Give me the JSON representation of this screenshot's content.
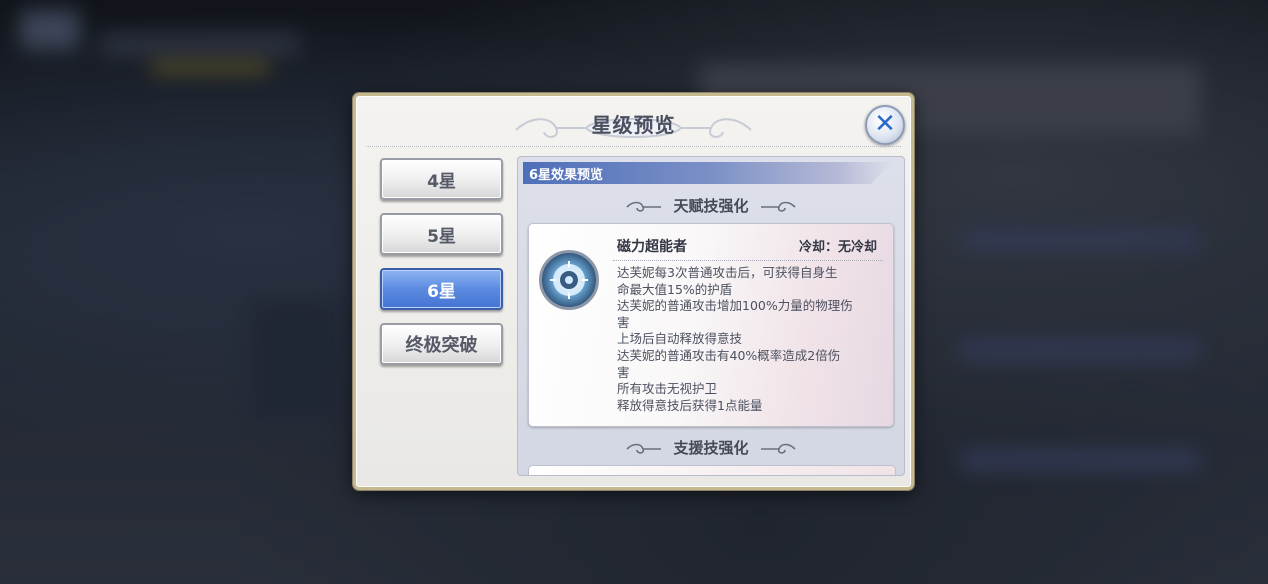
{
  "dialog": {
    "title": "星级预览",
    "close_icon": "close-icon"
  },
  "tabs": [
    {
      "label": "4星",
      "active": false
    },
    {
      "label": "5星",
      "active": false
    },
    {
      "label": "6星",
      "active": true
    },
    {
      "label": "终极突破",
      "active": false
    }
  ],
  "panel": {
    "header": "6星效果预览",
    "section1_title": "天赋技强化",
    "section2_title": "支援技强化",
    "skill": {
      "icon": "skill-emblem-icon",
      "name": "磁力超能者",
      "cooldown": "冷却：无冷却",
      "desc_lines": [
        "达芙妮每3次普通攻击后，可获得自身生",
        "命最大值15%的护盾",
        "达芙妮的普通攻击增加100%力量的物理伤",
        "害",
        "上场后自动释放得意技",
        "达芙妮的普通攻击有40%概率造成2倍伤",
        "害",
        "所有攻击无视护卫",
        "释放得意技后获得1点能量"
      ]
    }
  },
  "colors": {
    "active_tab": "#5a8ae0",
    "header_band": "#4e6fba",
    "frame_gold": "#c6b98f"
  }
}
